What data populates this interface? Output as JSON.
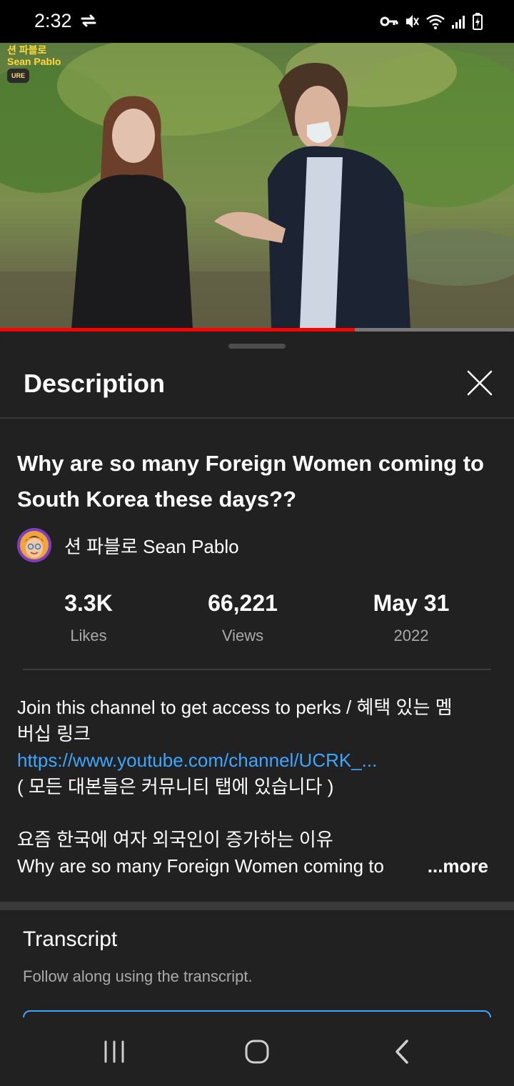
{
  "status_bar": {
    "time": "2:32"
  },
  "video": {
    "watermark_line1": "션 파블로",
    "watermark_line2": "Sean Pablo",
    "watermark_badge": "URE",
    "progress": 0.69,
    "accent_color": "#ff0000"
  },
  "sheet": {
    "title": "Description",
    "close_icon": "close-icon"
  },
  "video_info": {
    "title": "Why are so many Foreign Women coming to South Korea these days??",
    "channel_name": "션 파블로 Sean Pablo"
  },
  "stats": [
    {
      "value": "3.3K",
      "label": "Likes"
    },
    {
      "value": "66,221",
      "label": "Views"
    },
    {
      "value": "May 31",
      "label": "2022"
    }
  ],
  "description": {
    "line1": "Join this channel to get access to perks / 혜택 있는 멤",
    "line2": "버십 링크",
    "link": "https://www.youtube.com/channel/UCRK_...",
    "line3": "( 모든 대본들은 커뮤니티 탭에 있습니다 )",
    "line4": "요즘 한국에 여자 외국인이 증가하는 이유",
    "line5": "Why are so many Foreign Women coming to",
    "more_label": "...more"
  },
  "transcript": {
    "title": "Transcript",
    "subtitle": "Follow along using the transcript."
  },
  "link_color": "#3ea6ff"
}
